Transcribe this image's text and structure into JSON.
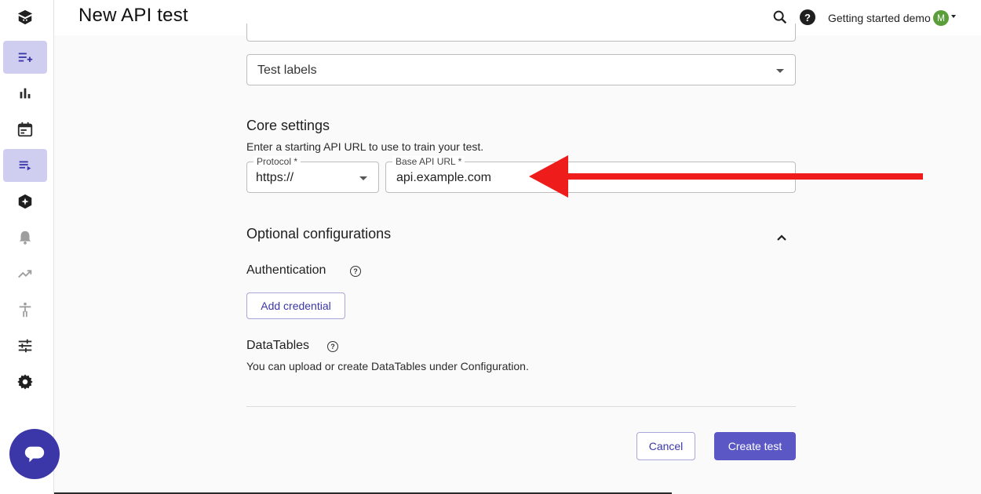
{
  "header": {
    "title": "New API test",
    "account_name": "Getting started demo",
    "avatar_initial": "M"
  },
  "sidebar": {
    "items": [
      {
        "name": "logo-icon"
      },
      {
        "name": "new-test-icon",
        "active": true
      },
      {
        "name": "bar-chart-icon"
      },
      {
        "name": "calendar-icon"
      },
      {
        "name": "test-list-icon",
        "active": true
      },
      {
        "name": "sparkle-hexagon-icon"
      },
      {
        "name": "bell-icon"
      },
      {
        "name": "trend-icon"
      },
      {
        "name": "accessibility-icon"
      },
      {
        "name": "sliders-icon"
      },
      {
        "name": "gear-icon"
      }
    ]
  },
  "form": {
    "test_labels_placeholder": "Test labels",
    "core": {
      "title": "Core settings",
      "description": "Enter a starting API URL to use to train your test.",
      "protocol_label": "Protocol *",
      "protocol_value": "https://",
      "base_url_label": "Base API URL *",
      "base_url_value": "api.example.com"
    },
    "optional": {
      "title": "Optional configurations",
      "authentication_title": "Authentication",
      "add_credential_label": "Add credential",
      "datatables_title": "DataTables",
      "datatables_desc": "You can upload or create DataTables under Configuration."
    },
    "actions": {
      "cancel_label": "Cancel",
      "create_label": "Create test"
    }
  },
  "colors": {
    "accent": "#5b58c6",
    "annotation_arrow": "#ef1c1c",
    "avatar": "#5a9e3a"
  }
}
